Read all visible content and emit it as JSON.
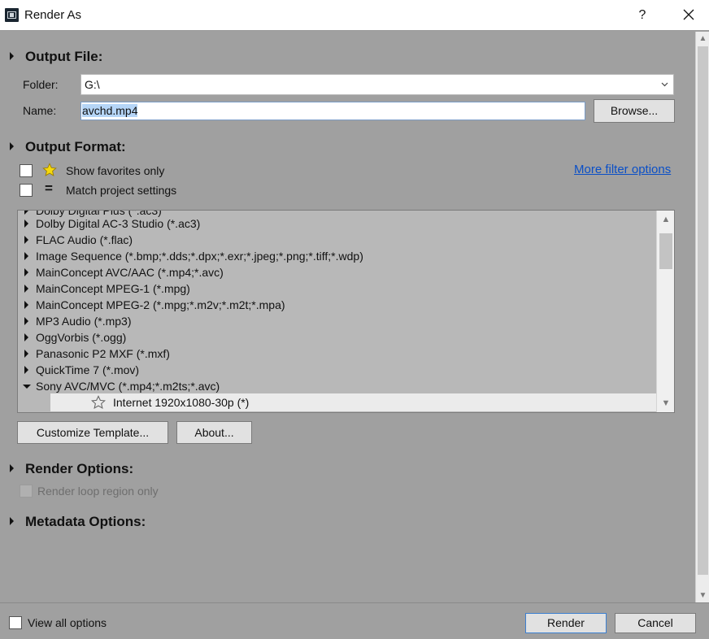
{
  "window": {
    "title": "Render As",
    "help": "?"
  },
  "output_file": {
    "title": "Output File:",
    "folder_label": "Folder:",
    "folder_value": "G:\\",
    "name_label": "Name:",
    "name_value": "avchd.mp4",
    "browse_label": "Browse..."
  },
  "output_format": {
    "title": "Output Format:",
    "show_favorites_label": "Show favorites only",
    "match_project_label": "Match project settings",
    "match_symbol": "=",
    "more_filter_label": "More filter options",
    "formats": [
      "Dolby Digital AC-3 Studio (*.ac3)",
      "FLAC Audio (*.flac)",
      "Image Sequence (*.bmp;*.dds;*.dpx;*.exr;*.jpeg;*.png;*.tiff;*.wdp)",
      "MainConcept AVC/AAC (*.mp4;*.avc)",
      "MainConcept MPEG-1 (*.mpg)",
      "MainConcept MPEG-2 (*.mpg;*.m2v;*.m2t;*.mpa)",
      "MP3 Audio (*.mp3)",
      "OggVorbis (*.ogg)",
      "Panasonic P2 MXF (*.mxf)",
      "QuickTime 7 (*.mov)"
    ],
    "expanded_format": "Sony AVC/MVC (*.mp4;*.m2ts;*.avc)",
    "selected_template": "Internet 1920x1080-30p (*)",
    "customize_label": "Customize Template...",
    "about_label": "About..."
  },
  "render_options": {
    "title": "Render Options:",
    "loop_region_label": "Render loop region only"
  },
  "metadata_options": {
    "title": "Metadata Options:"
  },
  "footer": {
    "view_all_label": "View all options",
    "render_label": "Render",
    "cancel_label": "Cancel"
  },
  "colors": {
    "accent": "#0a4fc7",
    "selection": "#b5d5f7",
    "background": "#a0a0a0"
  }
}
